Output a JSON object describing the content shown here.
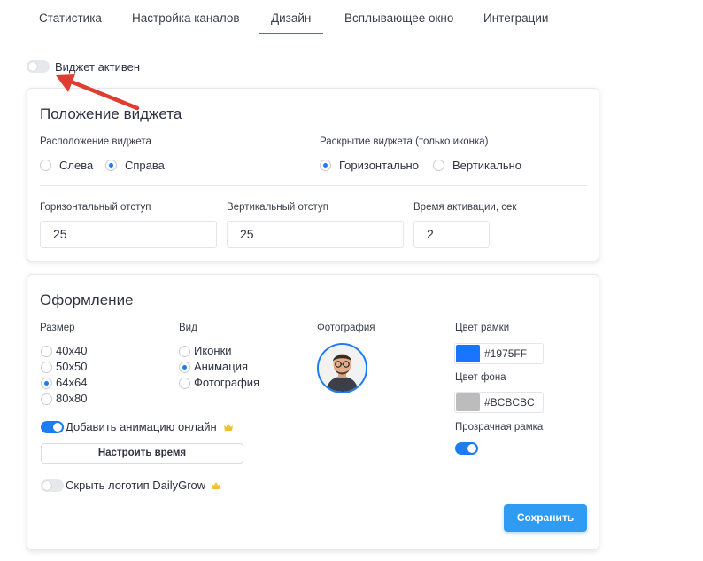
{
  "tabs": [
    {
      "label": "Статистика"
    },
    {
      "label": "Настройка каналов"
    },
    {
      "label": "Дизайн",
      "active": true
    },
    {
      "label": "Всплывающее окно"
    },
    {
      "label": "Интеграции"
    }
  ],
  "widget_active": {
    "label": "Виджет активен",
    "enabled": false
  },
  "position_card": {
    "title": "Положение виджета",
    "location": {
      "label": "Расположение виджета",
      "options": [
        "Слева",
        "Справа"
      ],
      "selected": "Справа"
    },
    "expand": {
      "label": "Раскрытие виджета (только иконка)",
      "options": [
        "Горизонтально",
        "Вертикально"
      ],
      "selected": "Горизонтально"
    },
    "h_offset": {
      "label": "Горизонтальный отступ",
      "value": "25"
    },
    "v_offset": {
      "label": "Вертикальный отступ",
      "value": "25"
    },
    "activation_time": {
      "label": "Время активации, сек",
      "value": "2"
    }
  },
  "design_card": {
    "title": "Оформление",
    "size": {
      "label": "Размер",
      "options": [
        "40x40",
        "50x50",
        "64x64",
        "80x80"
      ],
      "selected": "64x64"
    },
    "view": {
      "label": "Вид",
      "options": [
        "Иконки",
        "Анимация",
        "Фотография"
      ],
      "selected": "Анимация"
    },
    "photo": {
      "label": "Фотография"
    },
    "frame_color": {
      "label": "Цвет рамки",
      "value": "#1975FF"
    },
    "bg_color": {
      "label": "Цвет фона",
      "value": "#BCBCBC"
    },
    "transparent_frame": {
      "label": "Прозрачная рамка",
      "enabled": true
    },
    "online_animation": {
      "label": "Добавить анимацию онлайн",
      "enabled": true
    },
    "configure_time_button": "Настроить время",
    "hide_logo": {
      "label": "Скрыть логотип DailyGrow",
      "enabled": false
    },
    "save_button": "Сохранить"
  },
  "colors": {
    "accent": "#1d7cf2",
    "primary_button": "#2f9bf2",
    "annotation_arrow": "#e03c31",
    "premium_crown": "#f5c02e"
  }
}
